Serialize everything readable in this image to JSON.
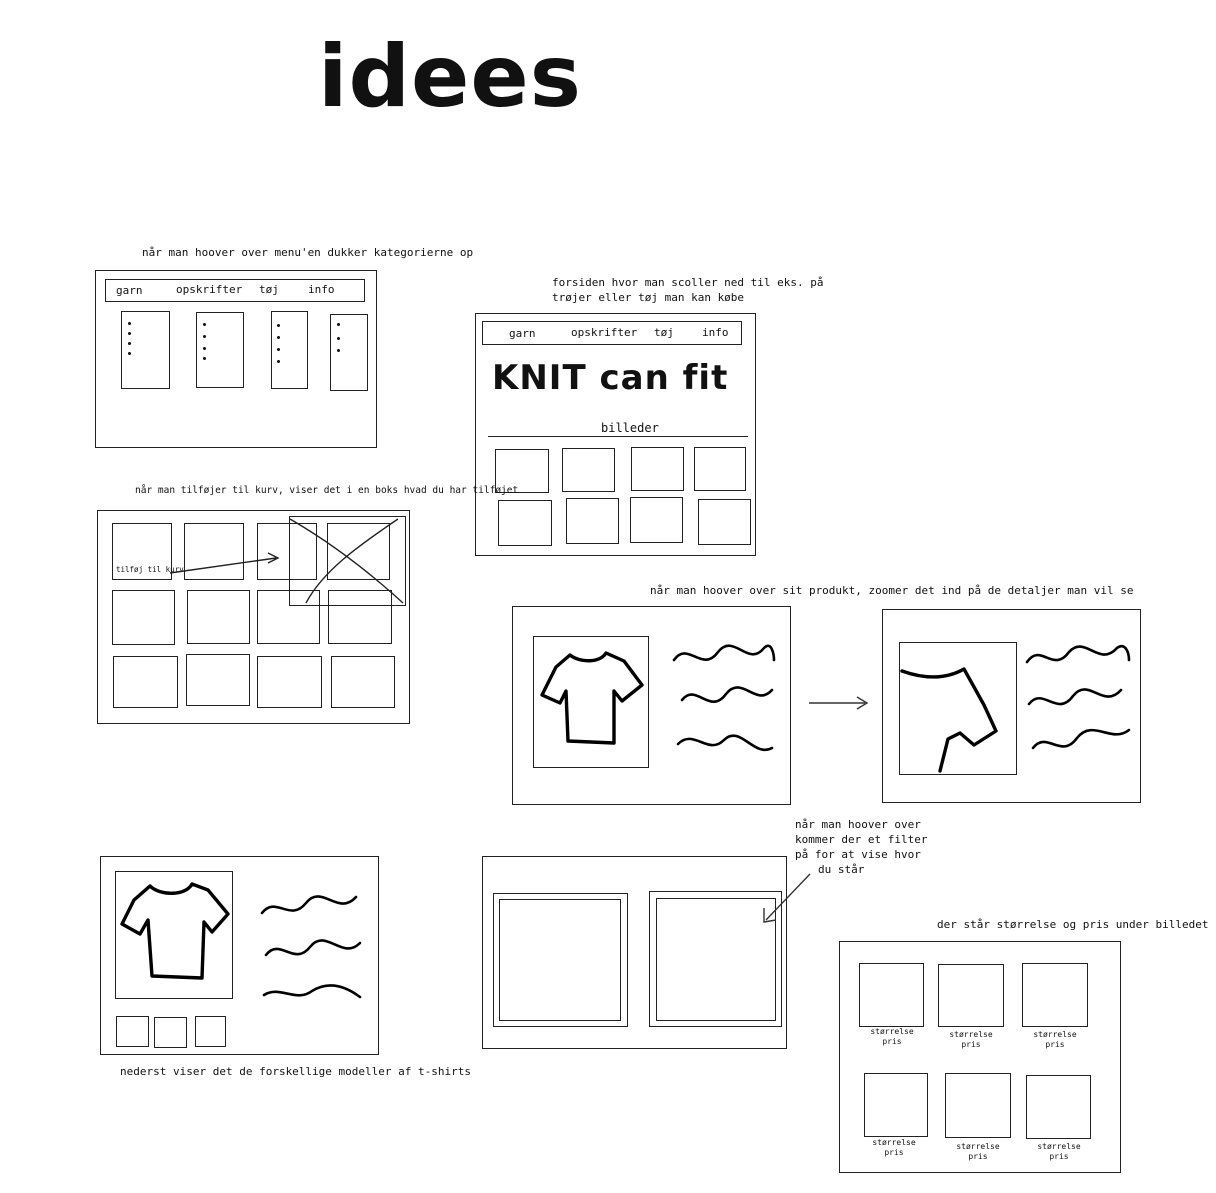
{
  "title": "idees",
  "notes": {
    "hover_menu": "når man hoover over menu'en dukker kategorierne op",
    "frontpage": [
      "forsiden hvor man scoller ned til eks. på",
      "trøjer eller tøj man kan købe"
    ],
    "cart": "når man tilføjer til kurv, viser det i en boks hvad du har tilføjet",
    "zoom": "når man hoover over sit produkt, zoomer det ind på de detaljer man vil se",
    "filter": [
      "når man hoover over",
      "kommer der et filter",
      "på for at vise hvor",
      "du står"
    ],
    "size_price": "der står størrelse og pris under billedet",
    "models": "nederst viser det de forskellige modeller af t-shirts"
  },
  "nav": [
    "garn",
    "opskrifter",
    "tøj",
    "info"
  ],
  "frontpage_nav": [
    "garn",
    "opskrifter",
    "tøj",
    "info"
  ],
  "brand": "KNIT can fit",
  "images_label": "billeder",
  "add_to_cart": "tilføj til kurv",
  "size_label": "størrelse",
  "price_label": "pris"
}
